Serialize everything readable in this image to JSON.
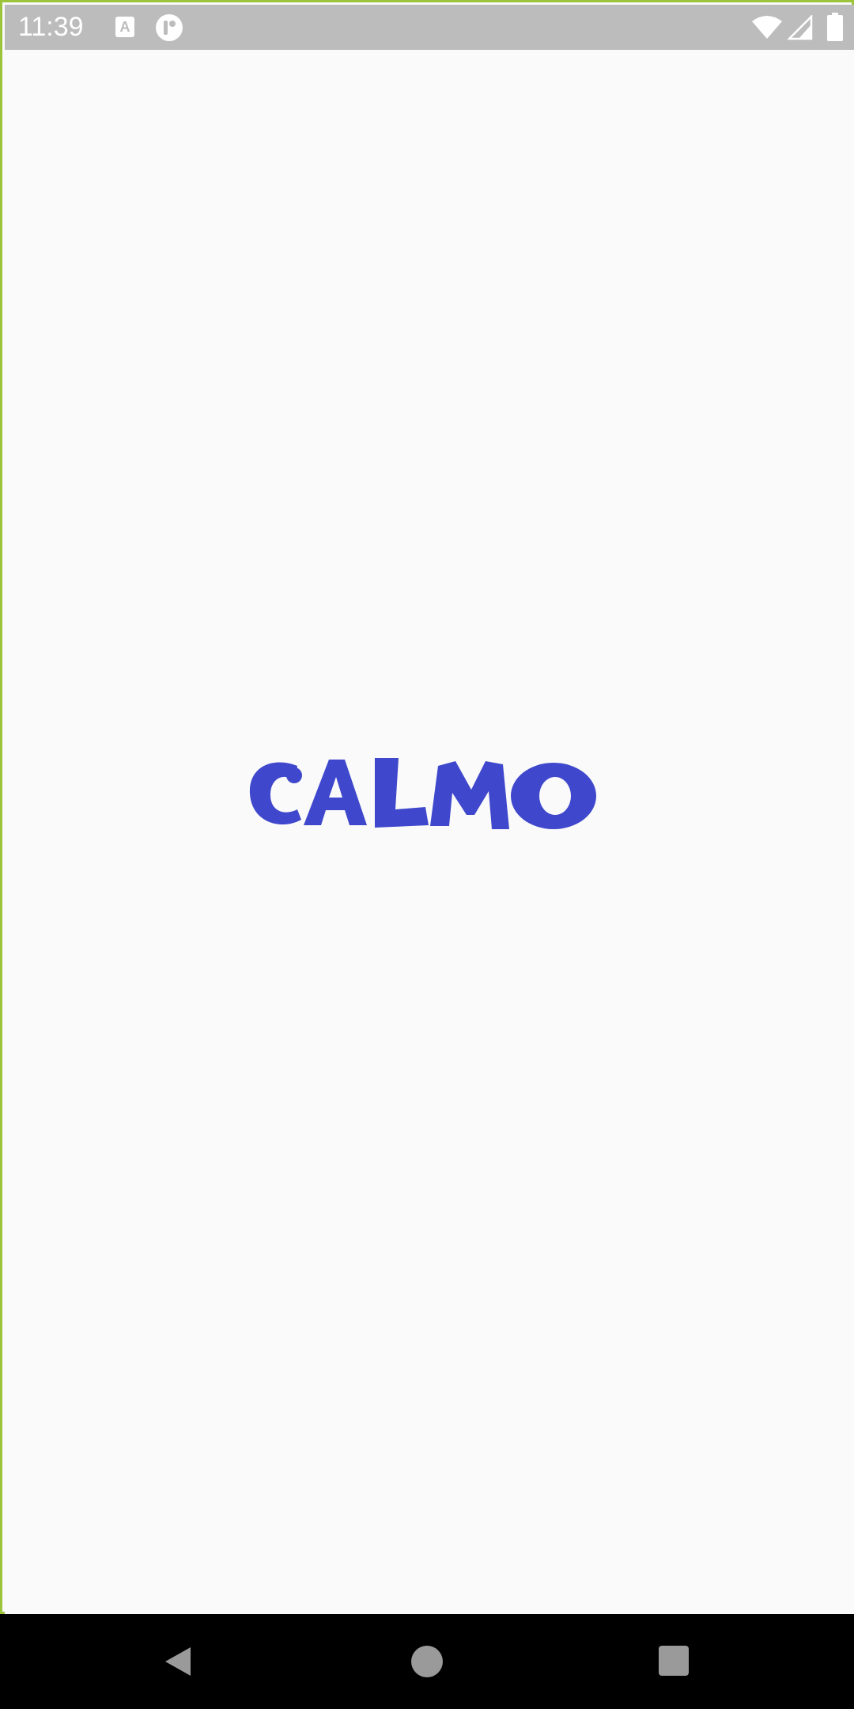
{
  "status_bar": {
    "time": "11:39",
    "notification_icons": [
      "text-a-icon",
      "app-notification-icon"
    ],
    "system_icons": [
      "wifi-icon",
      "cell-signal-icon",
      "battery-icon"
    ]
  },
  "splash": {
    "logo_text": "CALMO",
    "logo_color": "#3f48cc"
  },
  "nav_bar": {
    "buttons": [
      "back-icon",
      "home-icon",
      "recents-icon"
    ]
  },
  "colors": {
    "status_bar_bg": "#bcbcbc",
    "frame_border": "#9cc43a",
    "background": "#fafafa",
    "nav_bar_bg": "#000000"
  }
}
